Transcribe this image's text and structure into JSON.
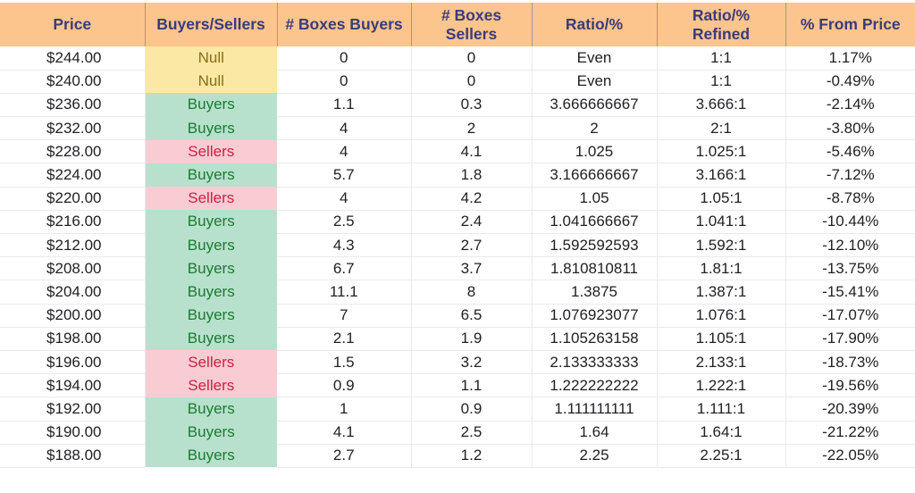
{
  "table": {
    "columns": [
      {
        "key": "price",
        "label": "Price"
      },
      {
        "key": "bs",
        "label": "Buyers/Sellers"
      },
      {
        "key": "boxes_buy",
        "label": "# Boxes Buyers"
      },
      {
        "key": "boxes_sell",
        "label": "# Boxes\nSellers"
      },
      {
        "key": "ratio",
        "label": "Ratio/%"
      },
      {
        "key": "ratio_ref",
        "label": "Ratio/%\nRefined"
      },
      {
        "key": "pct",
        "label": "% From Price"
      }
    ],
    "colors": {
      "header_bg": "#fbc58d",
      "header_text": "#3b3b7a",
      "buyers_bg": "#b7e1cd",
      "buyers_text": "#1b7a2f",
      "sellers_bg": "#f9ccd3",
      "sellers_text": "#cc1f40",
      "null_bg": "#fae8a4",
      "null_text": "#8a6d18",
      "grid_line": "#e8eaed",
      "body_text": "#202124"
    },
    "rows": [
      {
        "price": "$244.00",
        "bs": "Null",
        "status": "null",
        "boxes_buy": "0",
        "boxes_sell": "0",
        "ratio": "Even",
        "ratio_ref": "1:1",
        "pct": "1.17%"
      },
      {
        "price": "$240.00",
        "bs": "Null",
        "status": "null",
        "boxes_buy": "0",
        "boxes_sell": "0",
        "ratio": "Even",
        "ratio_ref": "1:1",
        "pct": "-0.49%"
      },
      {
        "price": "$236.00",
        "bs": "Buyers",
        "status": "buyers",
        "boxes_buy": "1.1",
        "boxes_sell": "0.3",
        "ratio": "3.666666667",
        "ratio_ref": "3.666:1",
        "pct": "-2.14%"
      },
      {
        "price": "$232.00",
        "bs": "Buyers",
        "status": "buyers",
        "boxes_buy": "4",
        "boxes_sell": "2",
        "ratio": "2",
        "ratio_ref": "2:1",
        "pct": "-3.80%"
      },
      {
        "price": "$228.00",
        "bs": "Sellers",
        "status": "sellers",
        "boxes_buy": "4",
        "boxes_sell": "4.1",
        "ratio": "1.025",
        "ratio_ref": "1.025:1",
        "pct": "-5.46%"
      },
      {
        "price": "$224.00",
        "bs": "Buyers",
        "status": "buyers",
        "boxes_buy": "5.7",
        "boxes_sell": "1.8",
        "ratio": "3.166666667",
        "ratio_ref": "3.166:1",
        "pct": "-7.12%"
      },
      {
        "price": "$220.00",
        "bs": "Sellers",
        "status": "sellers",
        "boxes_buy": "4",
        "boxes_sell": "4.2",
        "ratio": "1.05",
        "ratio_ref": "1.05:1",
        "pct": "-8.78%"
      },
      {
        "price": "$216.00",
        "bs": "Buyers",
        "status": "buyers",
        "boxes_buy": "2.5",
        "boxes_sell": "2.4",
        "ratio": "1.041666667",
        "ratio_ref": "1.041:1",
        "pct": "-10.44%"
      },
      {
        "price": "$212.00",
        "bs": "Buyers",
        "status": "buyers",
        "boxes_buy": "4.3",
        "boxes_sell": "2.7",
        "ratio": "1.592592593",
        "ratio_ref": "1.592:1",
        "pct": "-12.10%"
      },
      {
        "price": "$208.00",
        "bs": "Buyers",
        "status": "buyers",
        "boxes_buy": "6.7",
        "boxes_sell": "3.7",
        "ratio": "1.810810811",
        "ratio_ref": "1.81:1",
        "pct": "-13.75%"
      },
      {
        "price": "$204.00",
        "bs": "Buyers",
        "status": "buyers",
        "boxes_buy": "11.1",
        "boxes_sell": "8",
        "ratio": "1.3875",
        "ratio_ref": "1.387:1",
        "pct": "-15.41%"
      },
      {
        "price": "$200.00",
        "bs": "Buyers",
        "status": "buyers",
        "boxes_buy": "7",
        "boxes_sell": "6.5",
        "ratio": "1.076923077",
        "ratio_ref": "1.076:1",
        "pct": "-17.07%"
      },
      {
        "price": "$198.00",
        "bs": "Buyers",
        "status": "buyers",
        "boxes_buy": "2.1",
        "boxes_sell": "1.9",
        "ratio": "1.105263158",
        "ratio_ref": "1.105:1",
        "pct": "-17.90%"
      },
      {
        "price": "$196.00",
        "bs": "Sellers",
        "status": "sellers",
        "boxes_buy": "1.5",
        "boxes_sell": "3.2",
        "ratio": "2.133333333",
        "ratio_ref": "2.133:1",
        "pct": "-18.73%"
      },
      {
        "price": "$194.00",
        "bs": "Sellers",
        "status": "sellers",
        "boxes_buy": "0.9",
        "boxes_sell": "1.1",
        "ratio": "1.222222222",
        "ratio_ref": "1.222:1",
        "pct": "-19.56%"
      },
      {
        "price": "$192.00",
        "bs": "Buyers",
        "status": "buyers",
        "boxes_buy": "1",
        "boxes_sell": "0.9",
        "ratio": "1.111111111",
        "ratio_ref": "1.111:1",
        "pct": "-20.39%"
      },
      {
        "price": "$190.00",
        "bs": "Buyers",
        "status": "buyers",
        "boxes_buy": "4.1",
        "boxes_sell": "2.5",
        "ratio": "1.64",
        "ratio_ref": "1.64:1",
        "pct": "-21.22%"
      },
      {
        "price": "$188.00",
        "bs": "Buyers",
        "status": "buyers",
        "boxes_buy": "2.7",
        "boxes_sell": "1.2",
        "ratio": "2.25",
        "ratio_ref": "2.25:1",
        "pct": "-22.05%"
      }
    ]
  }
}
